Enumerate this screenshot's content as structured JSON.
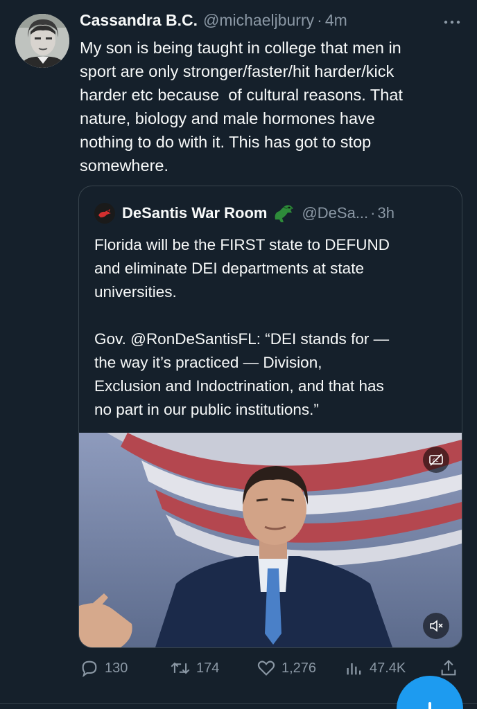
{
  "tweet": {
    "author_name": "Cassandra B.C.",
    "author_handle": "@michaeljburry",
    "separator": "·",
    "time": "4m",
    "text": "My son is being taught in college that men in\nsport are only stronger/faster/hit harder/kick\nharder etc because  of cultural reasons. That\nnature, biology and male hormones have\nnothing to do with it. This has got to stop\nsomewhere."
  },
  "quote": {
    "author_name": "DeSantis War Room",
    "author_handle": "@DeSa...",
    "separator": "·",
    "time": "3h",
    "text": "Florida will be the FIRST state to DEFUND\nand eliminate DEI departments at state\nuniversities.\n\nGov. @RonDeSantisFL: “DEI stands for —\nthe way it’s practiced — Division,\nExclusion and Indoctrination, and that has\nno part in our public institutions.”",
    "media_type": "video"
  },
  "actions": {
    "replies": "130",
    "retweets": "174",
    "likes": "1,276",
    "views": "47.4K"
  },
  "icons": [
    "more-icon",
    "logo-icon",
    "alligator-icon",
    "captions-off-icon",
    "mute-icon",
    "reply-icon",
    "retweet-icon",
    "like-icon",
    "views-icon",
    "share-icon",
    "compose-icon"
  ],
  "colors": {
    "background": "#15202b",
    "text": "#f7f9f9",
    "secondary": "#8b98a5",
    "border": "#38444d",
    "accent": "#1d9bf0"
  }
}
